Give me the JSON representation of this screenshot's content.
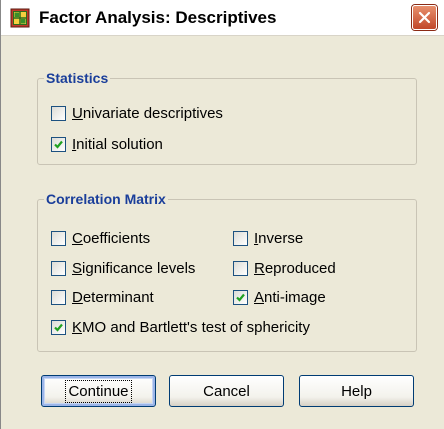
{
  "window": {
    "title": "Factor Analysis: Descriptives"
  },
  "statistics": {
    "title": "Statistics",
    "items": [
      {
        "before": "",
        "mnemonic": "U",
        "after": "nivariate descriptives",
        "checked": false
      },
      {
        "before": "",
        "mnemonic": "I",
        "after": "nitial solution",
        "checked": true
      }
    ]
  },
  "correlation": {
    "title": "Correlation Matrix",
    "items": [
      {
        "before": "",
        "mnemonic": "C",
        "after": "oefficients",
        "checked": false
      },
      {
        "before": "",
        "mnemonic": "I",
        "after": "nverse",
        "checked": false
      },
      {
        "before": "",
        "mnemonic": "S",
        "after": "ignificance levels",
        "checked": false
      },
      {
        "before": "",
        "mnemonic": "R",
        "after": "eproduced",
        "checked": false
      },
      {
        "before": "",
        "mnemonic": "D",
        "after": "eterminant",
        "checked": false
      },
      {
        "before": "",
        "mnemonic": "A",
        "after": "nti-image",
        "checked": true
      },
      {
        "before": "",
        "mnemonic": "K",
        "after": "MO and Bartlett's test of sphericity",
        "checked": true
      }
    ]
  },
  "buttons": {
    "continue": "Continue",
    "cancel": "Cancel",
    "help": "Help"
  },
  "colors": {
    "dialog_bg": "#ECE9D8",
    "group_title": "#1a3e9a",
    "close_button": "#c1472a"
  }
}
